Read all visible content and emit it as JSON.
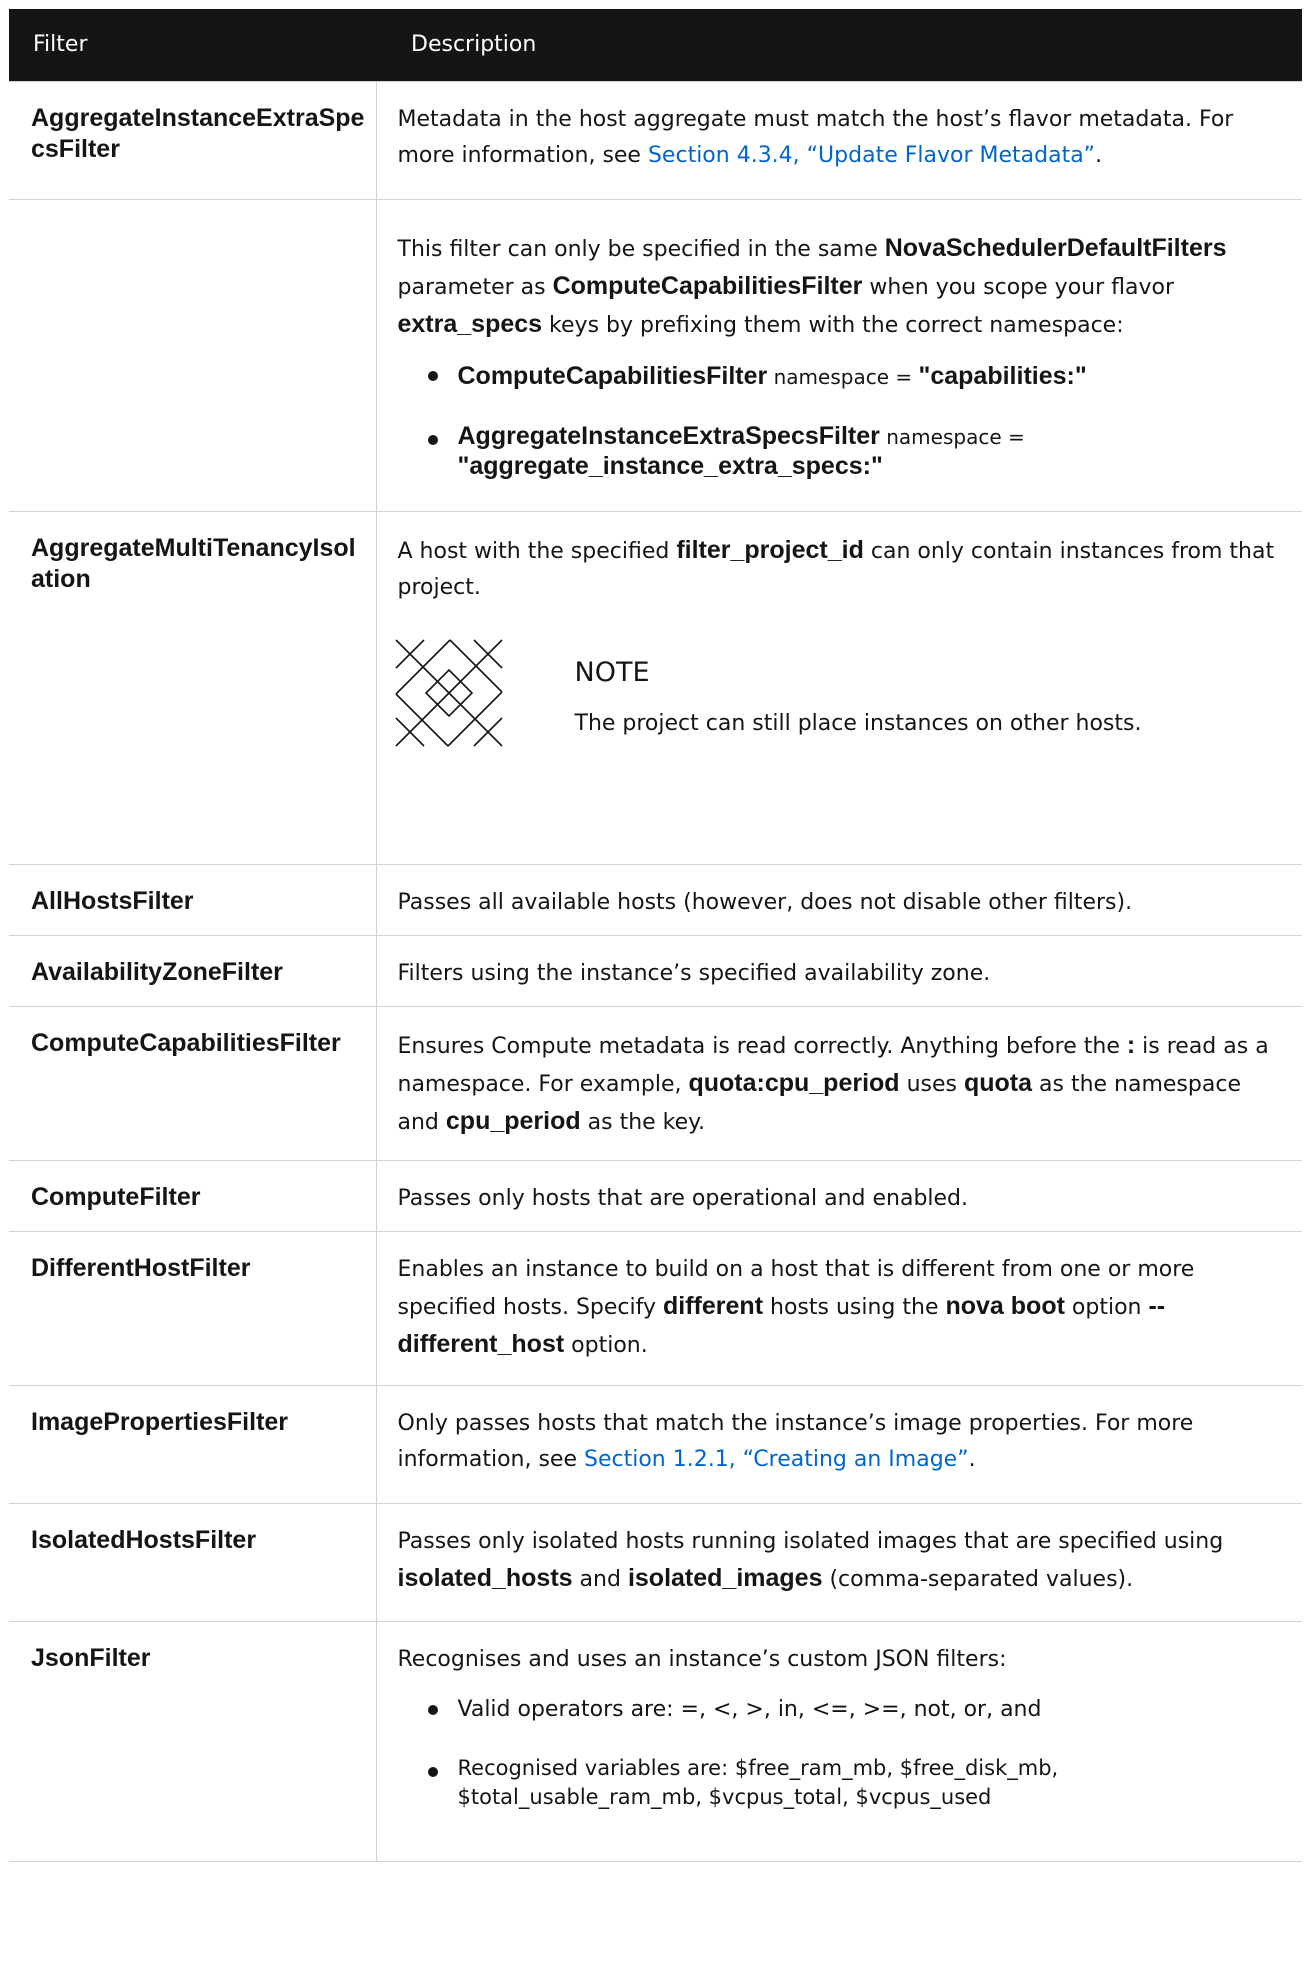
{
  "header": {
    "col_filter": "Filter",
    "col_description": "Description"
  },
  "rows": {
    "r0": {
      "name": "AggregateInstanceExtraSpecsFilter",
      "t1": "Metadata in the host aggregate must match the host’s flavor metadata. For more information, see ",
      "link": "Section 4.3.4, “Update Flavor Metadata”",
      "t2": "."
    },
    "r0b": {
      "t1": "This filter can only be specified in the same ",
      "b1": "NovaSchedulerDefaultFilters",
      "t2": " parameter as ",
      "b2": "ComputeCapabilitiesFilter",
      "t3": " when you scope your flavor ",
      "b3": "extra_specs",
      "t4": " keys by prefixing them with the correct namespace:",
      "li1_b1": "ComputeCapabilitiesFilter",
      "li1_t1": " namespace = ",
      "li1_b2": "\"capabilities:\"",
      "li2_b1": "AggregateInstanceExtraSpecsFilter",
      "li2_t1": " namespace = ",
      "li2_b2": "\"aggregate_instance_extra_specs:\""
    },
    "r1": {
      "name": "AggregateMultiTenancyIsolation",
      "t1": "A host with the specified ",
      "b1": "filter_project_id",
      "t2": " can only contain instances from that project.",
      "note_title": "NOTE",
      "note_body": "The project can still place instances on other hosts."
    },
    "r2": {
      "name": "AllHostsFilter",
      "desc": "Passes all available hosts (however, does not disable other filters)."
    },
    "r3": {
      "name": "AvailabilityZoneFilter",
      "desc": "Filters using the instance’s specified availability zone."
    },
    "r4": {
      "name": "ComputeCapabilitiesFilter",
      "t1": "Ensures Compute metadata is read correctly. Anything before the ",
      "b1": ":",
      "t2": " is read as a namespace. For example, ",
      "b2": "quota:cpu_period",
      "t3": " uses ",
      "b3": "quota",
      "t4": " as the namespace and ",
      "b4": "cpu_period",
      "t5": " as the key."
    },
    "r5": {
      "name": "ComputeFilter",
      "desc": "Passes only hosts that are operational and enabled."
    },
    "r6": {
      "name": "DifferentHostFilter",
      "t1": "Enables an instance to build on a host that is different from one or more specified hosts. Specify ",
      "b1": "different",
      "t2": " hosts using the ",
      "b2": "nova boot",
      "t3": " option ",
      "b3": "--different_host",
      "t4": " option."
    },
    "r7": {
      "name": "ImagePropertiesFilter",
      "t1": "Only passes hosts that match the instance’s image properties. For more information, see ",
      "link": "Section 1.2.1, “Creating an Image”",
      "t2": "."
    },
    "r8": {
      "name": "IsolatedHostsFilter",
      "t1": "Passes only isolated hosts running isolated images that are specified using ",
      "b1": "isolated_hosts",
      "t2": " and ",
      "b2": "isolated_images",
      "t3": " (comma-separated values)."
    },
    "r9": {
      "name": "JsonFilter",
      "t1": "Recognises and uses an instance’s custom JSON filters:",
      "li1": "Valid operators are: =, <, >, in, <=, >=, not, or, and",
      "li2": "Recognised variables are: $free_ram_mb, $free_disk_mb, $total_usable_ram_mb, $vcpus_total, $vcpus_used"
    }
  }
}
